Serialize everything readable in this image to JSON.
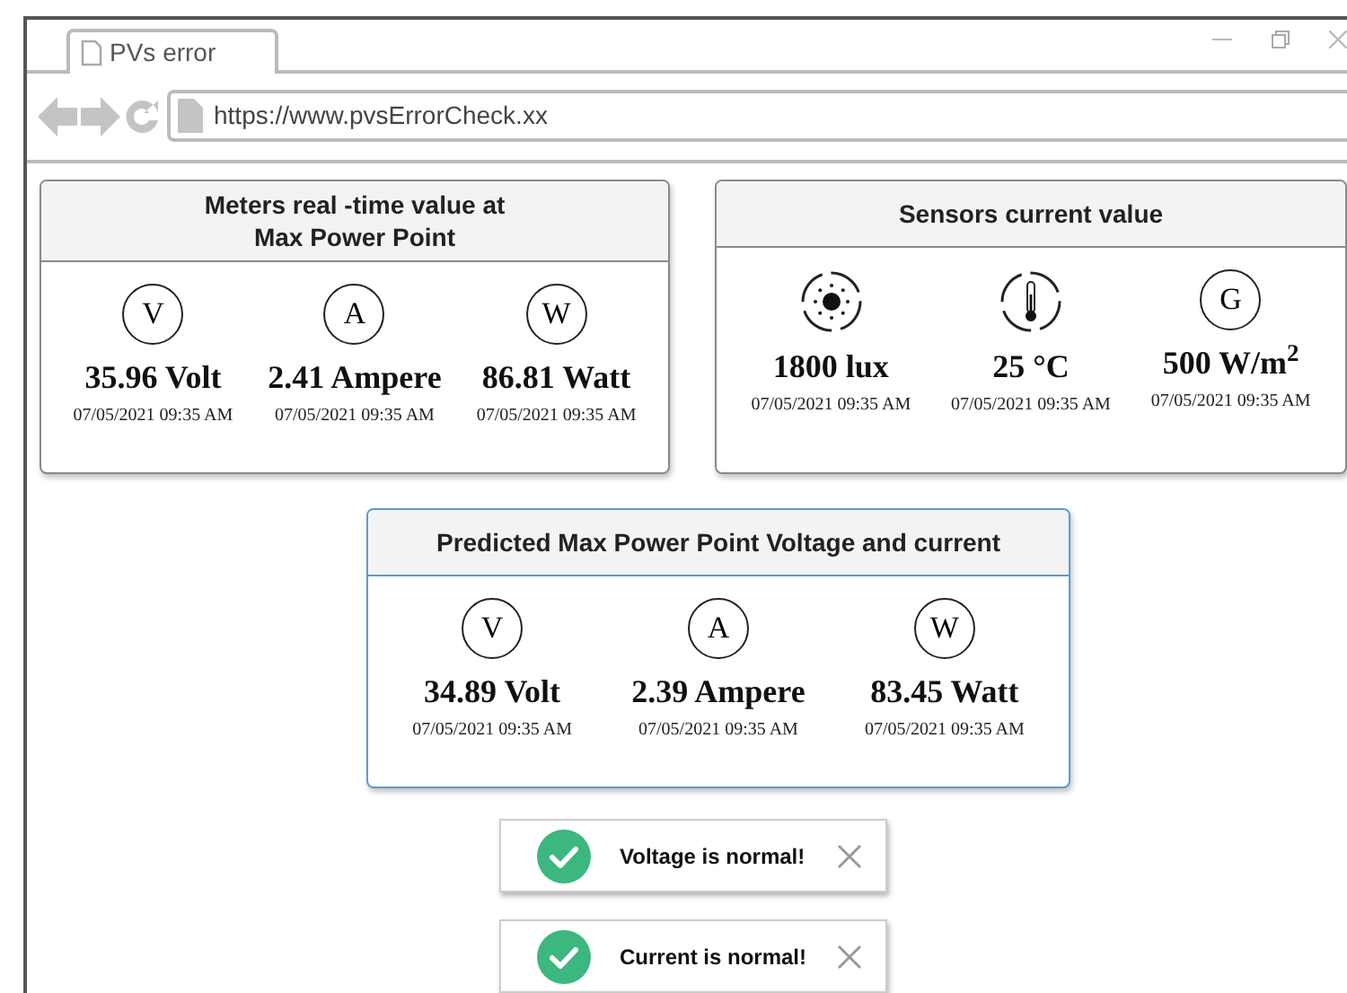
{
  "browser": {
    "tab": {
      "title": "PVs error"
    },
    "address": "https://www.pvsErrorCheck.xx"
  },
  "cards": [
    {
      "title": "Meters real -time value at\nMax Power Point",
      "highlighted": false,
      "readings": [
        {
          "kind": "letter",
          "symbol": "V",
          "value": "35.96 Volt",
          "time": "07/05/2021 09:35 AM"
        },
        {
          "kind": "letter",
          "symbol": "A",
          "value": "2.41 Ampere",
          "time": "07/05/2021 09:35 AM"
        },
        {
          "kind": "letter",
          "symbol": "W",
          "value": "86.81 Watt",
          "time": "07/05/2021 09:35 AM"
        }
      ]
    },
    {
      "title": "Sensors current value",
      "highlighted": false,
      "readings": [
        {
          "kind": "sun",
          "value": "1800 lux",
          "time": "07/05/2021 09:35 AM"
        },
        {
          "kind": "thermometer",
          "value": "25 °C",
          "time": "07/05/2021 09:35 AM"
        },
        {
          "kind": "letter",
          "symbol": "G",
          "value": "500  W/m$^{2}$",
          "time": "07/05/2021 09:35 AM"
        }
      ]
    },
    {
      "title": "Predicted Max Power Point Voltage and current",
      "highlighted": true,
      "readings": [
        {
          "kind": "letter",
          "symbol": "V",
          "value": "34.89 Volt",
          "time": "07/05/2021 09:35 AM"
        },
        {
          "kind": "letter",
          "symbol": "A",
          "value": "2.39 Ampere",
          "time": "07/05/2021 09:35 AM"
        },
        {
          "kind": "letter",
          "symbol": "W",
          "value": "83.45 Watt",
          "time": "07/05/2021 09:35 AM"
        }
      ]
    }
  ],
  "notifications": [
    {
      "message": "Voltage is normal!"
    },
    {
      "message": "Current is normal!"
    }
  ]
}
